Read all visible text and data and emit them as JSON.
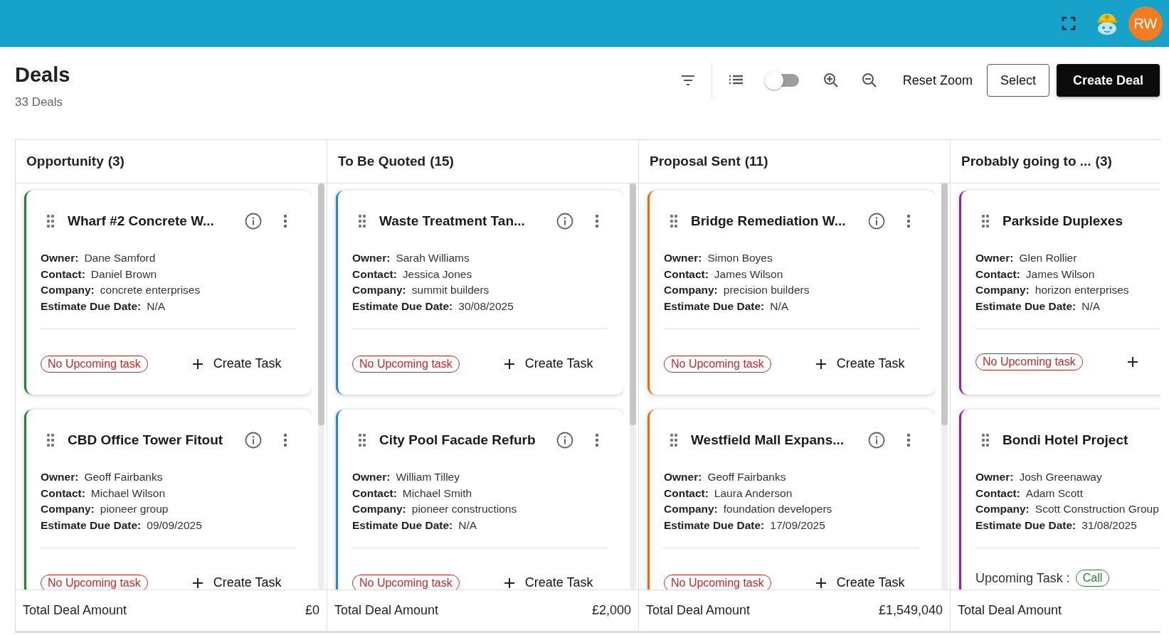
{
  "top_bar": {
    "avatar_initials": "RW"
  },
  "page": {
    "title": "Deals",
    "subtitle": "33 Deals"
  },
  "toolbar": {
    "view_toggle_on": false,
    "reset_zoom": "Reset Zoom",
    "select": "Select",
    "create": "Create Deal"
  },
  "columns": [
    {
      "name": "Opportunity",
      "count": "(3)",
      "color": "#2e7d32",
      "scrollbar": true,
      "total_label": "Total Deal Amount",
      "total": "£0",
      "cards": [
        {
          "title": "Wharf #2 Concrete W...",
          "actions": true,
          "fields": [
            {
              "label": "Owner:",
              "value": "Dane Samford"
            },
            {
              "label": "Contact:",
              "value": "Daniel Brown"
            },
            {
              "label": "Company:",
              "value": "concrete enterprises"
            },
            {
              "label": "Estimate Due Date:",
              "value": "N/A"
            }
          ],
          "task": {
            "kind": "none",
            "badge": "No Upcoming task",
            "create": "Create Task"
          }
        },
        {
          "title": "CBD Office Tower Fitout",
          "actions": true,
          "fields": [
            {
              "label": "Owner:",
              "value": "Geoff Fairbanks"
            },
            {
              "label": "Contact:",
              "value": "Michael Wilson"
            },
            {
              "label": "Company:",
              "value": "pioneer group"
            },
            {
              "label": "Estimate Due Date:",
              "value": "09/09/2025"
            }
          ],
          "task": {
            "kind": "none",
            "badge": "No Upcoming task",
            "create": "Create Task"
          }
        }
      ]
    },
    {
      "name": "To Be Quoted",
      "count": "(15)",
      "color": "#1e88e5",
      "scrollbar": true,
      "total_label": "Total Deal Amount",
      "total": "£2,000",
      "cards": [
        {
          "title": "Waste Treatment Tan...",
          "actions": true,
          "fields": [
            {
              "label": "Owner:",
              "value": "Sarah Williams"
            },
            {
              "label": "Contact:",
              "value": "Jessica Jones"
            },
            {
              "label": "Company:",
              "value": "summit builders"
            },
            {
              "label": "Estimate Due Date:",
              "value": "30/08/2025"
            }
          ],
          "task": {
            "kind": "none",
            "badge": "No Upcoming task",
            "create": "Create Task"
          }
        },
        {
          "title": "City Pool Facade Refurb",
          "actions": true,
          "fields": [
            {
              "label": "Owner:",
              "value": "William Tilley"
            },
            {
              "label": "Contact:",
              "value": "Michael Smith"
            },
            {
              "label": "Company:",
              "value": "pioneer constructions"
            },
            {
              "label": "Estimate Due Date:",
              "value": "N/A"
            }
          ],
          "task": {
            "kind": "none",
            "badge": "No Upcoming task",
            "create": "Create Task"
          }
        }
      ]
    },
    {
      "name": "Proposal Sent",
      "count": "(11)",
      "color": "#ef6c00",
      "scrollbar": true,
      "total_label": "Total Deal Amount",
      "total": "£1,549,040",
      "cards": [
        {
          "title": "Bridge Remediation W...",
          "actions": true,
          "fields": [
            {
              "label": "Owner:",
              "value": "Simon Boyes"
            },
            {
              "label": "Contact:",
              "value": "James Wilson"
            },
            {
              "label": "Company:",
              "value": "precision builders"
            },
            {
              "label": "Estimate Due Date:",
              "value": "N/A"
            }
          ],
          "task": {
            "kind": "none",
            "badge": "No Upcoming task",
            "create": "Create Task"
          }
        },
        {
          "title": "Westfield Mall Expans...",
          "actions": true,
          "fields": [
            {
              "label": "Owner:",
              "value": "Geoff Fairbanks"
            },
            {
              "label": "Contact:",
              "value": "Laura Anderson"
            },
            {
              "label": "Company:",
              "value": "foundation developers"
            },
            {
              "label": "Estimate Due Date:",
              "value": "17/09/2025"
            }
          ],
          "task": {
            "kind": "none",
            "badge": "No Upcoming task",
            "create": "Create Task"
          }
        }
      ]
    },
    {
      "name": "Probably going to ...",
      "count": "(3)",
      "color": "#8e24aa",
      "scrollbar": false,
      "total_label": "Total Deal Amount",
      "cards": [
        {
          "title": "Parkside Duplexes",
          "actions": false,
          "fields": [
            {
              "label": "Owner:",
              "value": "Glen Rollier"
            },
            {
              "label": "Contact:",
              "value": "James Wilson"
            },
            {
              "label": "Company:",
              "value": "horizon enterprises"
            },
            {
              "label": "Estimate Due Date:",
              "value": "N/A"
            }
          ],
          "task": {
            "kind": "none",
            "badge": "No Upcoming task"
          }
        },
        {
          "title": "Bondi Hotel Project",
          "actions": false,
          "fields": [
            {
              "label": "Owner:",
              "value": "Josh Greenaway"
            },
            {
              "label": "Contact:",
              "value": "Adam Scott"
            },
            {
              "label": "Company:",
              "value": "Scott Construction Group"
            },
            {
              "label": "Estimate Due Date:",
              "value": "31/08/2025"
            }
          ],
          "task": {
            "kind": "upcoming",
            "label": "Upcoming Task :",
            "badge": "Call"
          }
        }
      ]
    }
  ]
}
